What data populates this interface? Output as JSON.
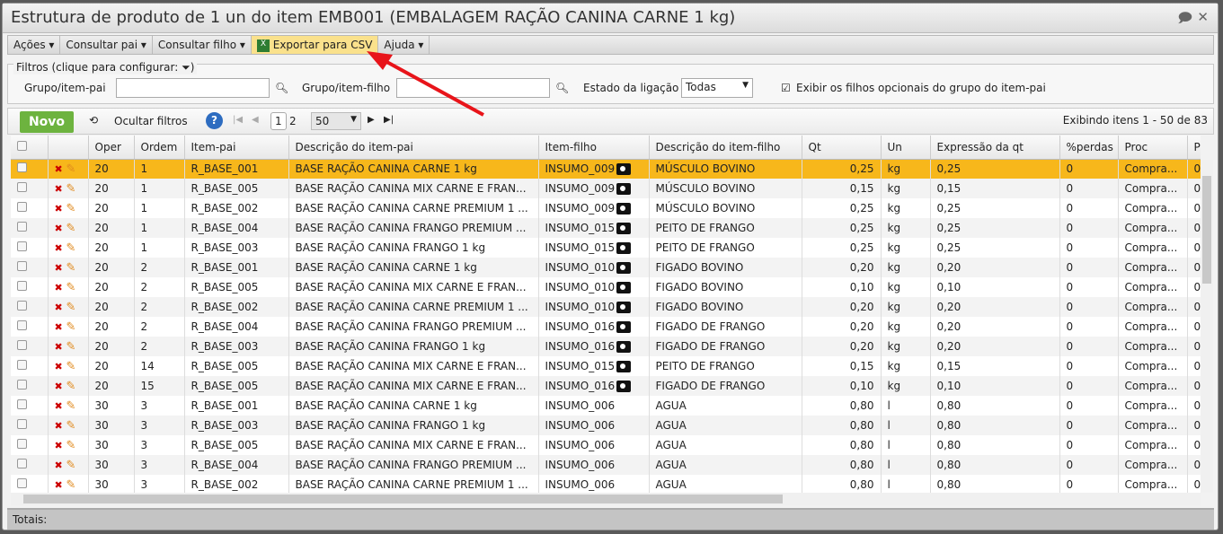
{
  "window": {
    "title": "Estrutura de produto de 1 un do item EMB001 (EMBALAGEM RAÇÃO CANINA CARNE 1 kg)"
  },
  "menu": [
    {
      "label": "Ações"
    },
    {
      "label": "Consultar pai"
    },
    {
      "label": "Consultar filho"
    },
    {
      "label": "Exportar para CSV"
    },
    {
      "label": "Ajuda"
    }
  ],
  "filters": {
    "legend": "Filtros (clique para configurar:",
    "parent_label": "Grupo/item-pai",
    "parent_value": "",
    "child_label": "Grupo/item-filho",
    "child_value": "",
    "state_label": "Estado da ligação",
    "state_value": "Todas",
    "optional_label": "Exibir os filhos opcionais do grupo do item-pai",
    "optional_checked": true
  },
  "toolbar": {
    "new": "Novo",
    "hide_filters": "Ocultar filtros",
    "page_current": "1",
    "page_next": "2",
    "page_size": "50",
    "summary": "Exibindo itens 1 - 50 de 83"
  },
  "columns": [
    "",
    "",
    "Oper",
    "Ordem",
    "Item-pai",
    "Descrição do item-pai",
    "Item-filho",
    "Descrição do item-filho",
    "Qt",
    "Un",
    "Expressão da qt",
    "%perdas",
    "Proc",
    "P"
  ],
  "rows": [
    [
      "20",
      "1",
      "R_BASE_001",
      "BASE RAÇÃO CANINA CARNE 1 kg",
      "INSUMO_009",
      "MÚSCULO BOVINO",
      "0,25",
      "kg",
      "0,25",
      "0",
      "Compra...",
      "0"
    ],
    [
      "20",
      "1",
      "R_BASE_005",
      "BASE RAÇÃO CANINA MIX CARNE E FRAN...",
      "INSUMO_009",
      "MÚSCULO BOVINO",
      "0,15",
      "kg",
      "0,15",
      "0",
      "Compra...",
      "0"
    ],
    [
      "20",
      "1",
      "R_BASE_002",
      "BASE RAÇÃO CANINA CARNE PREMIUM 1 ...",
      "INSUMO_009",
      "MÚSCULO BOVINO",
      "0,25",
      "kg",
      "0,25",
      "0",
      "Compra...",
      "0"
    ],
    [
      "20",
      "1",
      "R_BASE_004",
      "BASE RAÇÃO CANINA FRANGO PREMIUM ...",
      "INSUMO_015",
      "PEITO DE FRANGO",
      "0,25",
      "kg",
      "0,25",
      "0",
      "Compra...",
      "0"
    ],
    [
      "20",
      "1",
      "R_BASE_003",
      "BASE RAÇÃO CANINA FRANGO 1 kg",
      "INSUMO_015",
      "PEITO DE FRANGO",
      "0,25",
      "kg",
      "0,25",
      "0",
      "Compra...",
      "0"
    ],
    [
      "20",
      "2",
      "R_BASE_001",
      "BASE RAÇÃO CANINA CARNE 1 kg",
      "INSUMO_010",
      "FIGADO BOVINO",
      "0,20",
      "kg",
      "0,20",
      "0",
      "Compra...",
      "0"
    ],
    [
      "20",
      "2",
      "R_BASE_005",
      "BASE RAÇÃO CANINA MIX CARNE E FRAN...",
      "INSUMO_010",
      "FIGADO BOVINO",
      "0,10",
      "kg",
      "0,10",
      "0",
      "Compra...",
      "0"
    ],
    [
      "20",
      "2",
      "R_BASE_002",
      "BASE RAÇÃO CANINA CARNE PREMIUM 1 ...",
      "INSUMO_010",
      "FIGADO BOVINO",
      "0,20",
      "kg",
      "0,20",
      "0",
      "Compra...",
      "0"
    ],
    [
      "20",
      "2",
      "R_BASE_004",
      "BASE RAÇÃO CANINA FRANGO PREMIUM ...",
      "INSUMO_016",
      "FIGADO DE FRANGO",
      "0,20",
      "kg",
      "0,20",
      "0",
      "Compra...",
      "0"
    ],
    [
      "20",
      "2",
      "R_BASE_003",
      "BASE RAÇÃO CANINA FRANGO 1 kg",
      "INSUMO_016",
      "FIGADO DE FRANGO",
      "0,20",
      "kg",
      "0,20",
      "0",
      "Compra...",
      "0"
    ],
    [
      "20",
      "14",
      "R_BASE_005",
      "BASE RAÇÃO CANINA MIX CARNE E FRAN...",
      "INSUMO_015",
      "PEITO DE FRANGO",
      "0,15",
      "kg",
      "0,15",
      "0",
      "Compra...",
      "0"
    ],
    [
      "20",
      "15",
      "R_BASE_005",
      "BASE RAÇÃO CANINA MIX CARNE E FRAN...",
      "INSUMO_016",
      "FIGADO DE FRANGO",
      "0,10",
      "kg",
      "0,10",
      "0",
      "Compra...",
      "0"
    ],
    [
      "30",
      "3",
      "R_BASE_001",
      "BASE RAÇÃO CANINA CARNE 1 kg",
      "INSUMO_006",
      "AGUA",
      "0,80",
      "l",
      "0,80",
      "0",
      "Compra...",
      "0"
    ],
    [
      "30",
      "3",
      "R_BASE_003",
      "BASE RAÇÃO CANINA FRANGO 1 kg",
      "INSUMO_006",
      "AGUA",
      "0,80",
      "l",
      "0,80",
      "0",
      "Compra...",
      "0"
    ],
    [
      "30",
      "3",
      "R_BASE_005",
      "BASE RAÇÃO CANINA MIX CARNE E FRAN...",
      "INSUMO_006",
      "AGUA",
      "0,80",
      "l",
      "0,80",
      "0",
      "Compra...",
      "0"
    ],
    [
      "30",
      "3",
      "R_BASE_004",
      "BASE RAÇÃO CANINA FRANGO PREMIUM ...",
      "INSUMO_006",
      "AGUA",
      "0,80",
      "l",
      "0,80",
      "0",
      "Compra...",
      "0"
    ],
    [
      "30",
      "3",
      "R_BASE_002",
      "BASE RAÇÃO CANINA CARNE PREMIUM 1 ...",
      "INSUMO_006",
      "AGUA",
      "0,80",
      "l",
      "0,80",
      "0",
      "Compra...",
      "0"
    ]
  ],
  "camera_rows": 12,
  "footer": {
    "totals": "Totais:"
  },
  "colors": {
    "selected_row": "#f7b71b",
    "new_button": "#6db33f",
    "highlight_menu": "#fae18c",
    "arrow": "#e8141a"
  }
}
